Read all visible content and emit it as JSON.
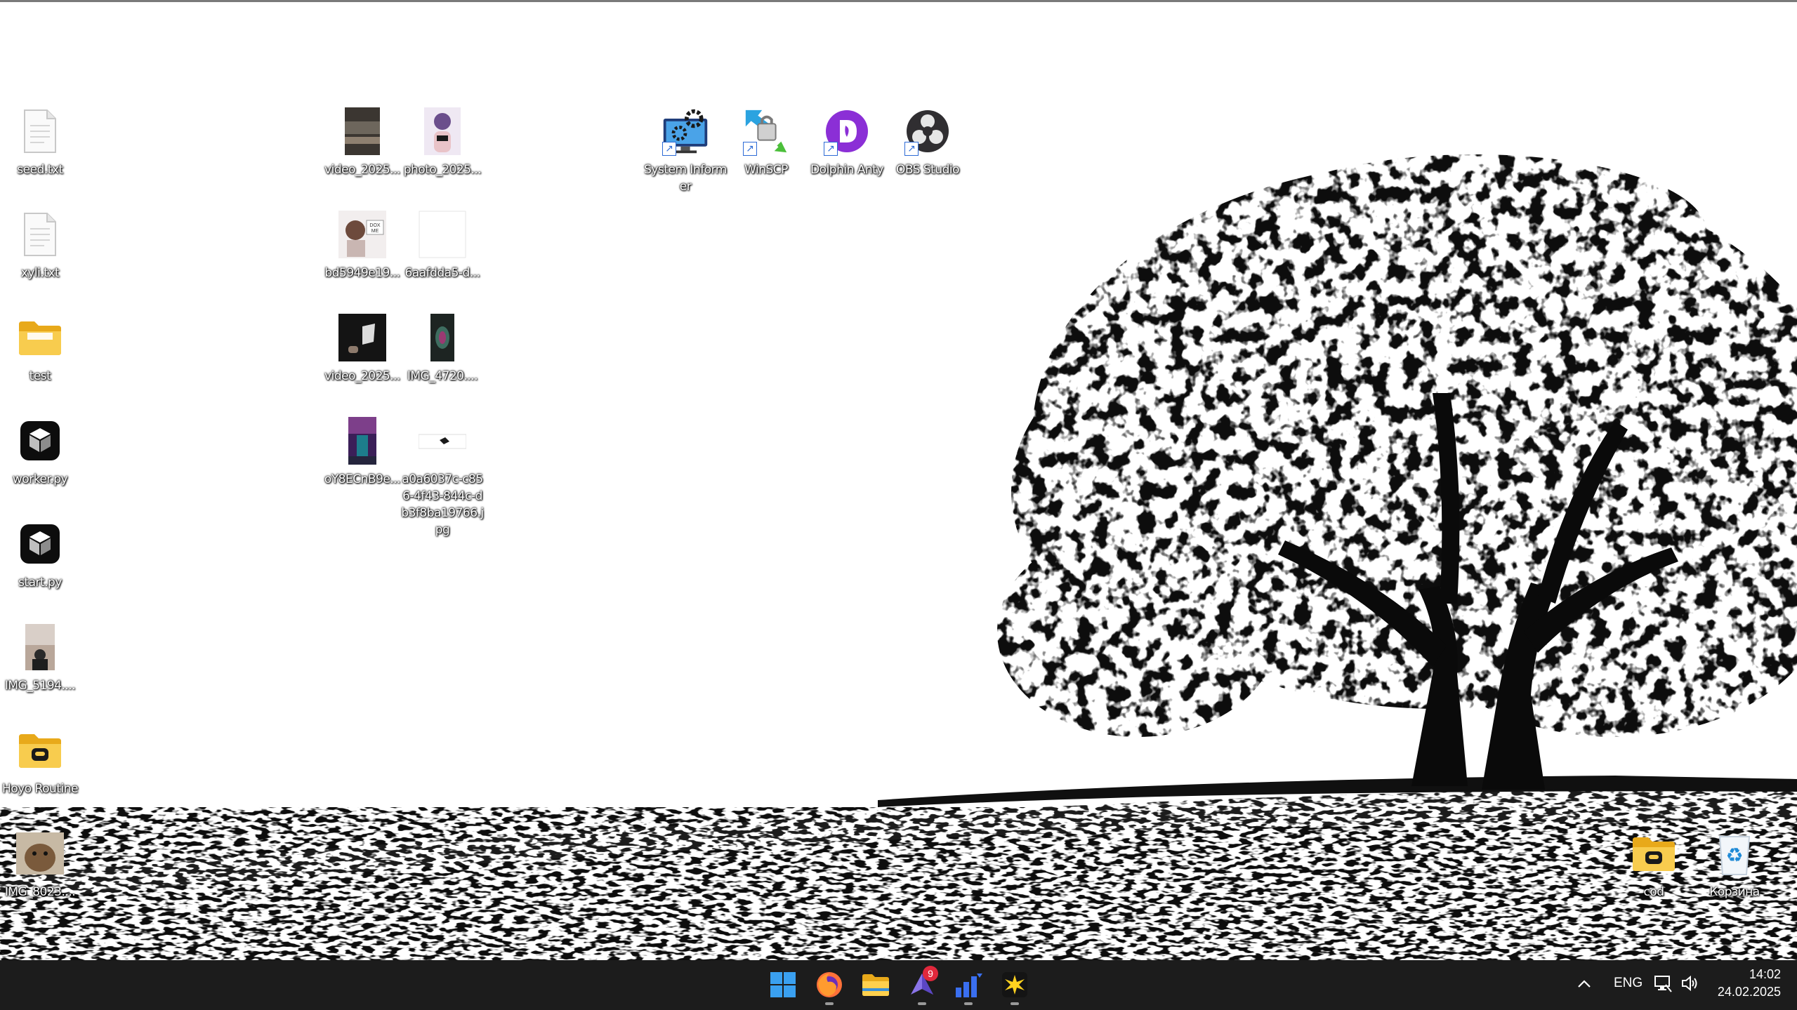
{
  "desktop": {
    "icons": [
      {
        "label": "seed.txt",
        "icon": "text-file-icon"
      },
      {
        "label": "xyli.txt",
        "icon": "text-file-icon"
      },
      {
        "label": "test",
        "icon": "folder-icon"
      },
      {
        "label": "worker.py",
        "icon": "python-cube-icon"
      },
      {
        "label": "start.py",
        "icon": "python-cube-icon"
      },
      {
        "label": "IMG_5194....",
        "icon": "image-thumbnail-icon"
      },
      {
        "label": "Hoyo Routine",
        "icon": "folder-icon"
      },
      {
        "label": "IMG_8023....",
        "icon": "image-thumbnail-icon"
      },
      {
        "label": "video_2025...",
        "icon": "video-thumbnail-icon"
      },
      {
        "label": "photo_2025...",
        "icon": "image-thumbnail-icon"
      },
      {
        "label": "bd5949e19...",
        "icon": "image-thumbnail-icon"
      },
      {
        "label": "6aafdda5-d...",
        "icon": "blank-file-icon"
      },
      {
        "label": "video_2025...",
        "icon": "video-thumbnail-icon"
      },
      {
        "label": "IMG_4720....",
        "icon": "image-thumbnail-icon"
      },
      {
        "label": "oY8ECnB9e...",
        "icon": "image-thumbnail-icon"
      },
      {
        "label": "a0a6037c-c856-4f43-844c-db3f8ba19766.jpg",
        "icon": "image-thumbnail-icon"
      },
      {
        "label": "System Informer",
        "icon": "system-informer-icon"
      },
      {
        "label": "WinSCP",
        "icon": "winscp-icon"
      },
      {
        "label": "Dolphin Anty",
        "icon": "dolphin-anty-icon"
      },
      {
        "label": "OBS Studio",
        "icon": "obs-studio-icon"
      },
      {
        "label": "cod",
        "icon": "folder-icon"
      },
      {
        "label": "Корзина",
        "icon": "recycle-bin-icon"
      }
    ]
  },
  "taskbar": {
    "apps": [
      {
        "name": "start",
        "icon": "windows-start-icon"
      },
      {
        "name": "firefox",
        "icon": "firefox-icon"
      },
      {
        "name": "file-explorer",
        "icon": "folder-icon"
      },
      {
        "name": "messenger",
        "icon": "paper-plane-icon",
        "badge": "9"
      },
      {
        "name": "stats",
        "icon": "bar-chart-icon"
      },
      {
        "name": "burst",
        "icon": "starburst-icon"
      }
    ],
    "tray": {
      "language": "ENG",
      "time": "14:02",
      "date": "24.02.2025"
    }
  },
  "colors": {
    "taskbar_bg": "#1c1c1c",
    "folder_yellow": "#f5c542",
    "badge_red": "#e0283c",
    "accent_blue": "#2d6bd6"
  }
}
